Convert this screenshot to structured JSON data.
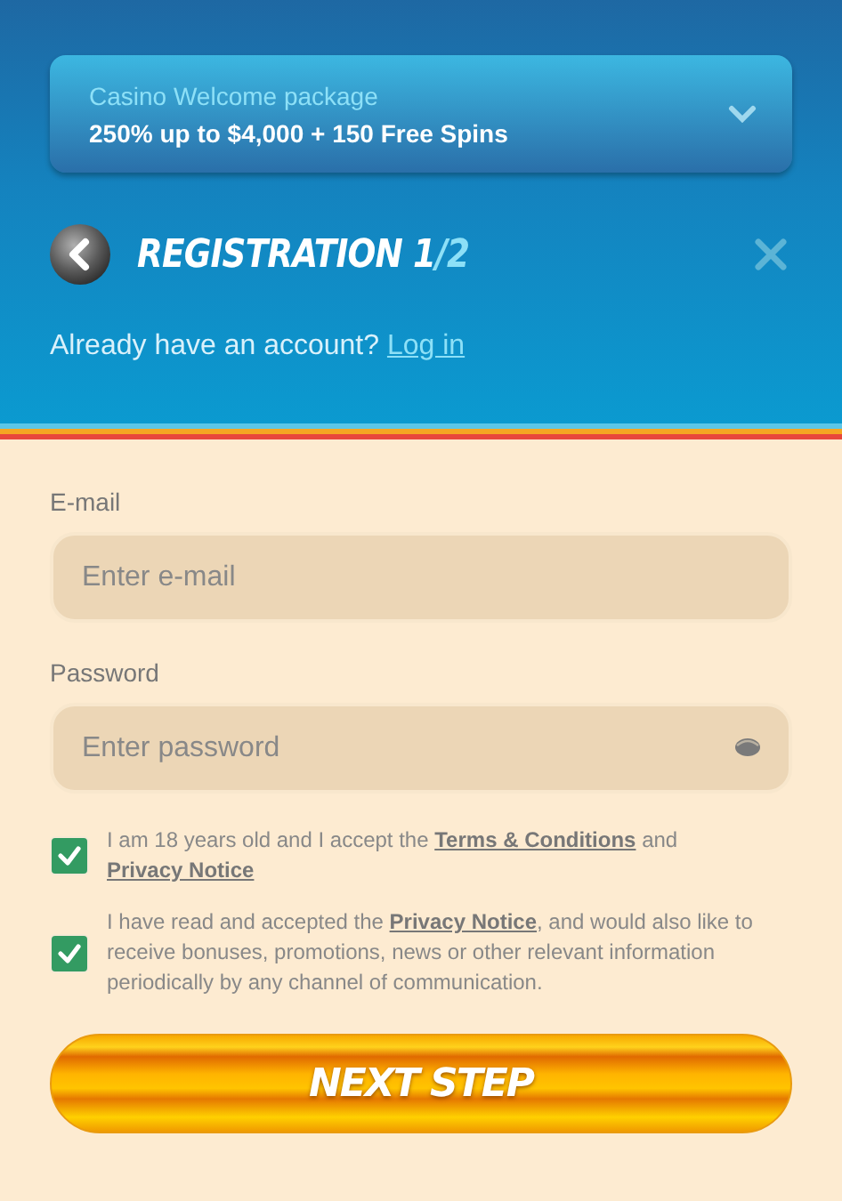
{
  "promo": {
    "label": "Casino Welcome package",
    "offer": "250% up to $4,000 + 150 Free Spins",
    "expanded": false
  },
  "header": {
    "title": "REGISTRATION 1",
    "step": "/2"
  },
  "login_prompt": {
    "text": "Already have an account?",
    "link": "Log in"
  },
  "fields": [
    {
      "label": "E-mail",
      "placeholder": "Enter e-mail",
      "kind": "text"
    },
    {
      "label": "Password",
      "placeholder": "Enter password",
      "kind": "password"
    }
  ],
  "consents": [
    {
      "checked": true,
      "segments": [
        {
          "text": "I am 18 years old and I accept the ",
          "link": false
        },
        {
          "text": "Terms & Conditions",
          "link": true
        },
        {
          "text": " and ",
          "link": false
        },
        {
          "text": "Privacy Notice",
          "link": true
        }
      ]
    },
    {
      "checked": true,
      "segments": [
        {
          "text": "I have read and accepted the ",
          "link": false
        },
        {
          "text": "Privacy Notice",
          "link": true
        },
        {
          "text": ", and would also like to receive bonuses, promotions, news or other relevant information periodically by any channel of communication.",
          "link": false
        }
      ]
    }
  ],
  "submit": "NEXT STEP"
}
